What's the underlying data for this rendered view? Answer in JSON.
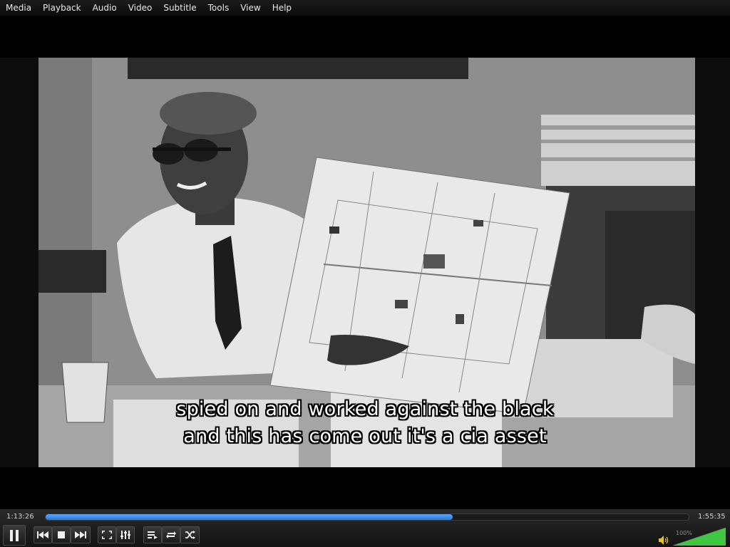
{
  "menu": {
    "items": [
      "Media",
      "Playback",
      "Audio",
      "Video",
      "Subtitle",
      "Tools",
      "View",
      "Help"
    ]
  },
  "subtitle": {
    "line1": "spied on and worked against the black",
    "line2": "and this has come out it's a cia asset"
  },
  "playback": {
    "elapsed": "1:13:26",
    "total": "1:55:35",
    "progress": 0.6335
  },
  "volume": {
    "label": "100%",
    "level": 1.0
  },
  "colors": {
    "accent": "#3d8de8",
    "volume_fill": "#3fc83f"
  },
  "icons": {
    "pause": "pause-icon",
    "prev": "previous-icon",
    "stop": "stop-icon",
    "next": "next-icon",
    "fullscreen": "fullscreen-icon",
    "extended": "equalizer-icon",
    "playlist": "playlist-icon",
    "loop": "loop-icon",
    "random": "shuffle-icon",
    "speaker": "speaker-icon"
  }
}
